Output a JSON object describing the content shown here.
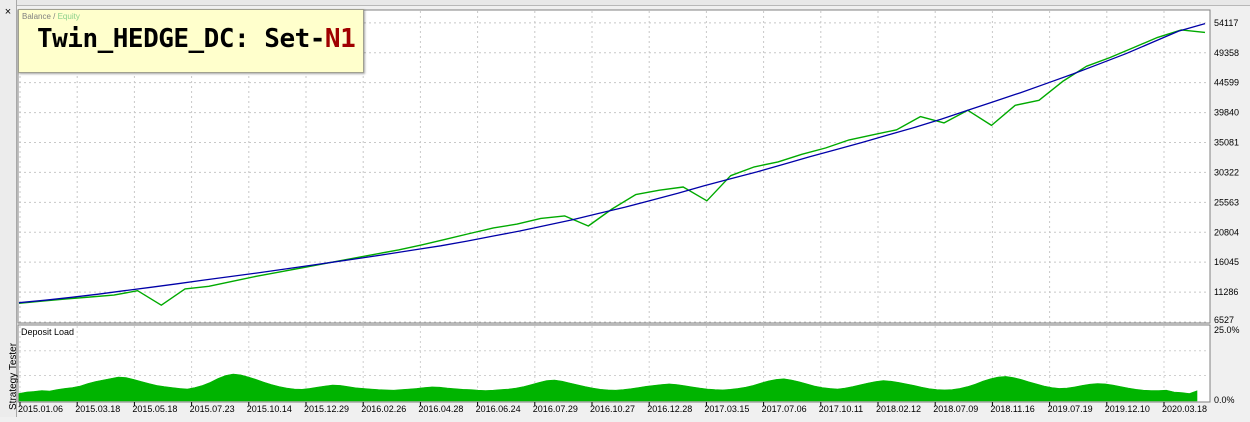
{
  "window": {
    "close_glyph": "×",
    "side_label": "Strategy Tester"
  },
  "legend": {
    "balance": "Balance",
    "separator": " / ",
    "equity": "Equity"
  },
  "title": {
    "main": "Twin_HEDGE_DC:  Set-",
    "accent": "N1"
  },
  "colors": {
    "balance": "#0000a8",
    "equity": "#00aa00",
    "deposit_load": "#00b400",
    "title_accent": "#a00000",
    "title_bg": "#ffffcc"
  },
  "deposit_load": {
    "title": "Deposit Load",
    "y_ticks": [
      "25.0%",
      "0.0%"
    ],
    "ylim": [
      0,
      25
    ],
    "values": [
      2.5,
      3.0,
      3.2,
      3.5,
      3.3,
      3.8,
      4.2,
      4.5,
      5.0,
      5.8,
      6.5,
      7.0,
      7.5,
      8.0,
      7.8,
      7.2,
      6.5,
      5.8,
      5.2,
      4.8,
      4.5,
      4.2,
      4.0,
      4.5,
      5.2,
      6.2,
      7.5,
      8.5,
      9.0,
      8.7,
      8.0,
      7.2,
      6.3,
      5.5,
      4.8,
      4.3,
      4.0,
      3.9,
      4.2,
      4.6,
      5.0,
      5.3,
      5.2,
      4.8,
      4.4,
      4.2,
      4.0,
      3.8,
      3.7,
      3.6,
      3.8,
      4.0,
      4.2,
      4.5,
      4.7,
      4.6,
      4.3,
      4.1,
      3.9,
      3.8,
      3.6,
      3.5,
      3.6,
      3.8,
      4.0,
      4.3,
      4.8,
      5.5,
      6.2,
      6.8,
      7.0,
      6.6,
      6.0,
      5.4,
      4.8,
      4.3,
      3.9,
      3.7,
      3.6,
      3.8,
      4.1,
      4.5,
      4.9,
      5.2,
      5.5,
      5.7,
      5.5,
      5.1,
      4.7,
      4.3,
      4.0,
      3.8,
      3.7,
      3.9,
      4.2,
      4.6,
      5.2,
      6.0,
      6.7,
      7.2,
      7.4,
      7.0,
      6.4,
      5.7,
      5.0,
      4.5,
      4.2,
      4.0,
      4.3,
      4.8,
      5.4,
      6.0,
      6.5,
      6.8,
      6.6,
      6.2,
      5.7,
      5.2,
      4.6,
      4.1,
      3.8,
      3.7,
      3.8,
      4.2,
      4.8,
      5.6,
      6.6,
      7.4,
      8.0,
      8.2,
      7.8,
      7.2,
      6.4,
      5.7,
      5.0,
      4.5,
      4.2,
      4.3,
      4.7,
      5.2,
      5.6,
      5.8,
      5.7,
      5.3,
      4.8,
      4.3,
      3.9,
      3.6,
      3.5,
      3.5,
      3.6,
      3.0,
      2.8,
      2.5,
      3.4
    ]
  },
  "chart_data": {
    "type": "line",
    "title": "Twin_HEDGE_DC:  Set-N1",
    "ylim": [
      6527,
      56000
    ],
    "y_ticks": [
      54117,
      49358,
      44599,
      39840,
      35081,
      30322,
      25563,
      20804,
      16045,
      11286,
      6527
    ],
    "x_ticks": [
      "2015.01.06",
      "2015.03.18",
      "2015.05.18",
      "2015.07.23",
      "2015.10.14",
      "2015.12.29",
      "2016.02.26",
      "2016.04.28",
      "2016.06.24",
      "2016.07.29",
      "2016.10.27",
      "2016.12.28",
      "2017.03.15",
      "2017.07.06",
      "2017.10.11",
      "2018.02.12",
      "2018.07.09",
      "2018.11.16",
      "2019.07.19",
      "2019.12.10",
      "2020.03.18"
    ],
    "grid": true,
    "legend": "top-left",
    "series": [
      {
        "name": "Balance",
        "values": [
          9600,
          10000,
          10450,
          10950,
          11500,
          12050,
          12600,
          13200,
          13750,
          14300,
          14900,
          15500,
          16100,
          16700,
          17350,
          18000,
          18650,
          19400,
          20200,
          21000,
          21900,
          22800,
          23800,
          24800,
          25900,
          27000,
          28200,
          29300,
          30400,
          31600,
          32800,
          33950,
          35100,
          36300,
          37500,
          38800,
          40200,
          41600,
          43000,
          44500,
          46000,
          47600,
          49200,
          51000,
          52800,
          54000
        ]
      },
      {
        "name": "Equity",
        "values": [
          9500,
          9850,
          10200,
          10500,
          10800,
          11500,
          9200,
          11800,
          12200,
          13000,
          13800,
          14500,
          15200,
          15900,
          16600,
          17300,
          18000,
          18800,
          19700,
          20600,
          21500,
          22100,
          23000,
          23400,
          21800,
          24500,
          26800,
          27500,
          28000,
          25800,
          29800,
          31200,
          32000,
          33200,
          34200,
          35500,
          36300,
          37100,
          39200,
          38200,
          40200,
          37800,
          41000,
          41800,
          44800,
          47200,
          48600,
          50200,
          51800,
          53000,
          52600
        ]
      }
    ]
  }
}
